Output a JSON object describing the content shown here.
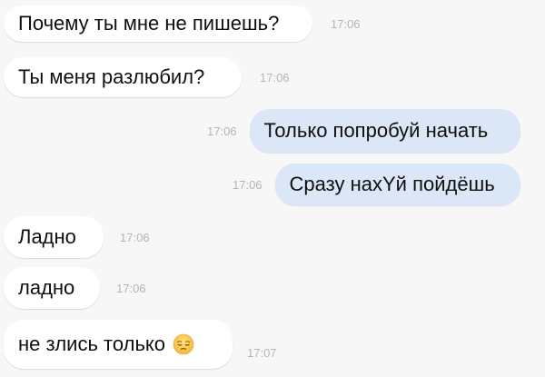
{
  "messages": [
    {
      "text": "Почему ты мне не пишешь?",
      "time": "17:06",
      "direction": "in"
    },
    {
      "text": "Ты меня разлюбил?",
      "time": "17:06",
      "direction": "in"
    },
    {
      "text": "Только попробуй начать",
      "time": "17:06",
      "direction": "out"
    },
    {
      "text": "Сразу нахYй пойдёшь",
      "time": "17:06",
      "direction": "out"
    },
    {
      "text": "Ладно",
      "time": "17:06",
      "direction": "in"
    },
    {
      "text": "ладно",
      "time": "17:06",
      "direction": "in"
    },
    {
      "text": "не злись только",
      "time": "17:07",
      "direction": "in",
      "emoji": "pensive-face-icon"
    }
  ],
  "colors": {
    "incoming_bubble": "#ffffff",
    "outgoing_bubble": "#dbe7f6",
    "timestamp": "#b4b4b4",
    "background": "#f7f7f7"
  }
}
